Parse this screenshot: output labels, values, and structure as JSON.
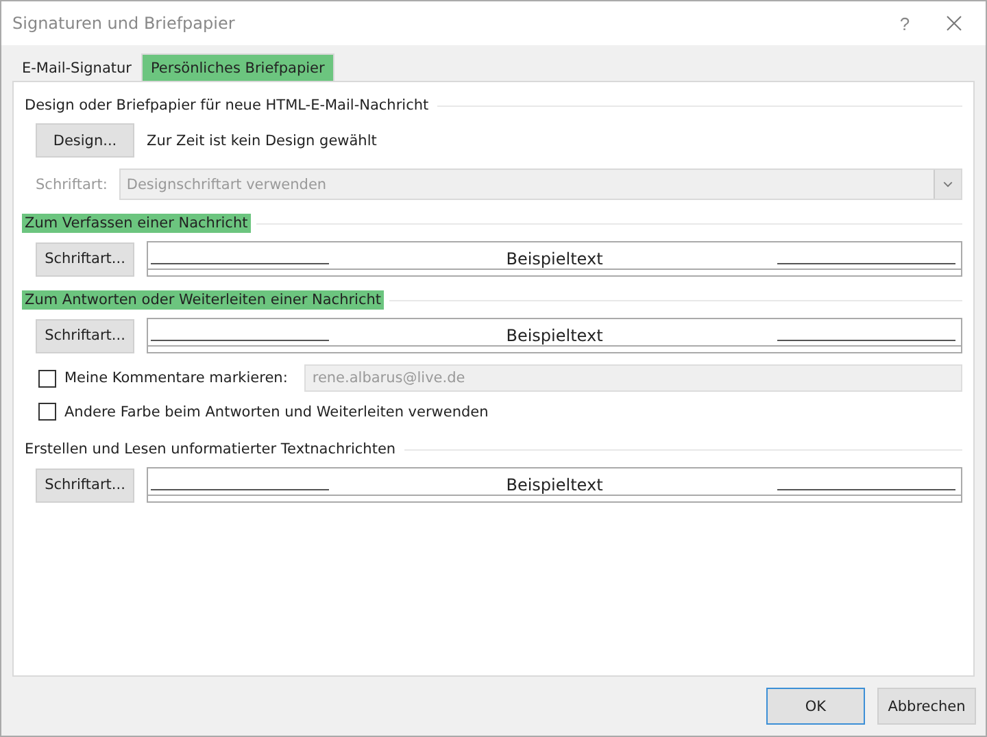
{
  "window": {
    "title": "Signaturen und Briefpapier",
    "help": "?"
  },
  "tabs": [
    {
      "label": "E-Mail-Signatur",
      "selected": false,
      "highlighted": false
    },
    {
      "label": "Persönliches Briefpapier",
      "selected": true,
      "highlighted": true
    }
  ],
  "sections": [
    {
      "kind": "design",
      "heading": "Design oder Briefpapier für neue HTML-E-Mail-Nachricht",
      "highlighted": false,
      "button": "Design...",
      "status": "Zur Zeit ist kein Design gewählt",
      "font_label": "Schriftart:",
      "font_select": {
        "value": "Designschriftart verwenden",
        "disabled": true
      }
    },
    {
      "kind": "font",
      "heading": "Zum Verfassen einer Nachricht",
      "highlighted": true,
      "button": "Schriftart...",
      "preview": "Beispieltext"
    },
    {
      "kind": "font",
      "heading": "Zum Antworten oder Weiterleiten einer Nachricht",
      "highlighted": true,
      "button": "Schriftart...",
      "preview": "Beispieltext",
      "options": [
        {
          "label": "Meine Kommentare markieren:",
          "checked": false,
          "field": {
            "value": "rene.albarus@live.de",
            "disabled": true
          }
        },
        {
          "label": "Andere Farbe beim Antworten und Weiterleiten verwenden",
          "checked": false
        }
      ]
    },
    {
      "kind": "font",
      "heading": "Erstellen und Lesen unformatierter Textnachrichten",
      "highlighted": false,
      "button": "Schriftart...",
      "preview": "Beispieltext"
    }
  ],
  "buttons": [
    {
      "label": "OK",
      "default": true
    },
    {
      "label": "Abbrechen",
      "default": false
    }
  ]
}
